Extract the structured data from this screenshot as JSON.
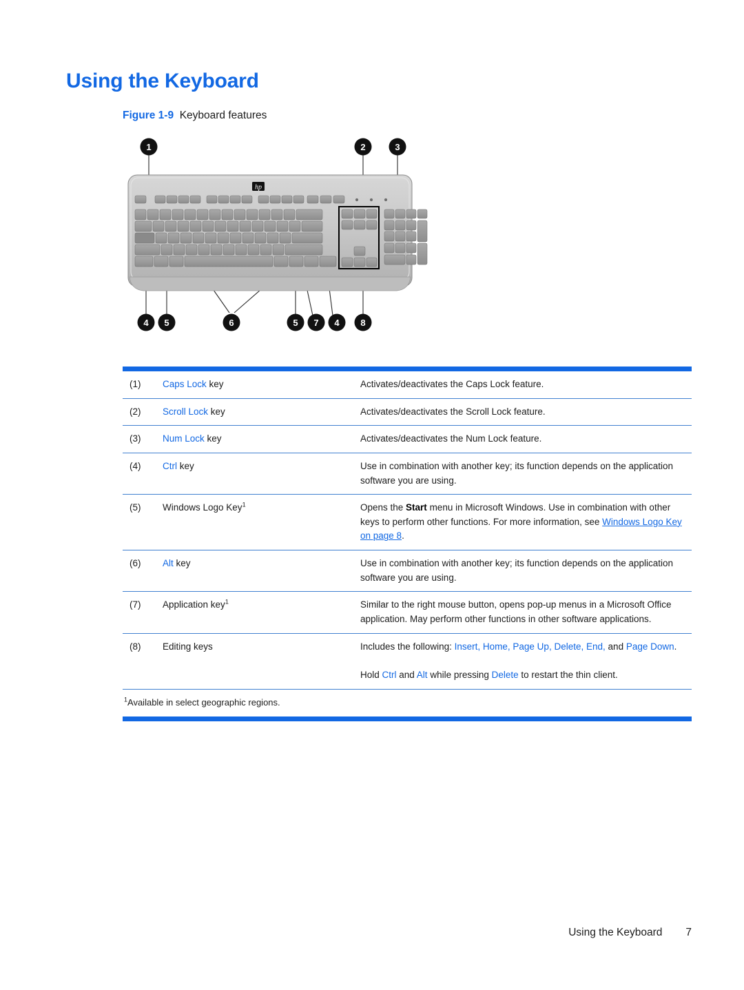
{
  "heading": "Using the Keyboard",
  "figure": {
    "label": "Figure 1-9",
    "caption": "Keyboard features",
    "alt_name": "keyboard-diagram",
    "callouts": [
      "1",
      "2",
      "3",
      "4",
      "5",
      "6",
      "5",
      "7",
      "4",
      "8"
    ],
    "brand_logo": "hp"
  },
  "table": {
    "rows": [
      {
        "num": "(1)",
        "name_link": "Caps Lock",
        "name_rest": " key",
        "desc": "Activates/deactivates the Caps Lock feature."
      },
      {
        "num": "(2)",
        "name_link": "Scroll Lock",
        "name_rest": " key",
        "desc": "Activates/deactivates the Scroll Lock feature."
      },
      {
        "num": "(3)",
        "name_link": "Num Lock",
        "name_rest": " key",
        "desc": "Activates/deactivates the Num Lock feature."
      },
      {
        "num": "(4)",
        "name_link": "Ctrl",
        "name_rest": " key",
        "desc": "Use in combination with another key; its function depends on the application software you are using."
      },
      {
        "num": "(5)",
        "name_plain": "Windows Logo Key",
        "name_sup": "1",
        "desc_part1": "Opens the ",
        "desc_bold": "Start",
        "desc_part2": " menu in Microsoft Windows. Use in combination with other keys to perform other functions. For more information, see ",
        "desc_link": "Windows Logo Key on page 8",
        "desc_part3": "."
      },
      {
        "num": "(6)",
        "name_link": "Alt",
        "name_rest": " key",
        "desc": "Use in combination with another key; its function depends on the application software you are using."
      },
      {
        "num": "(7)",
        "name_plain": "Application key",
        "name_sup": "1",
        "desc": "Similar to the right mouse button, opens pop-up menus in a Microsoft Office application. May perform other functions in other software applications."
      },
      {
        "num": "(8)",
        "name_plain": "Editing keys",
        "desc_intro": "Includes the following: ",
        "desc_keys": [
          "Insert,",
          "Home,",
          "Page Up,",
          "Delete,",
          "End,"
        ],
        "desc_and": " and ",
        "desc_last_key": "Page Down",
        "desc_period": ".",
        "desc2_p1": "Hold ",
        "desc2_k1": "Ctrl",
        "desc2_p2": " and ",
        "desc2_k2": "Alt",
        "desc2_p3": " while pressing ",
        "desc2_k3": "Delete",
        "desc2_p4": " to restart the thin client."
      }
    ],
    "footnote_sup": "1",
    "footnote_text": "Available in select geographic regions."
  },
  "footer": {
    "title": "Using the Keyboard",
    "page_number": "7"
  },
  "colors": {
    "accent_blue": "#1268e3",
    "rule_blue": "#3f7fd0",
    "text": "#1b1b1b"
  }
}
